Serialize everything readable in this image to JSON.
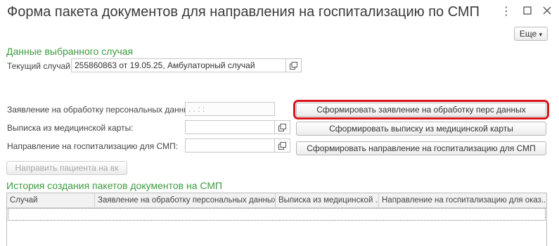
{
  "window": {
    "title": "Форма пакета документов для направления на госпитализацию по СМП",
    "more_label": "Еще"
  },
  "section_selected": {
    "title": "Данные выбранного случая",
    "current_case_label": "Текущий случай:",
    "current_case_value": "255860863 от 19.05.25, Амбулаторный случай"
  },
  "documents": {
    "consent_label": "Заявление на обработку персональных данных:",
    "consent_value": " .  .      :  :",
    "extract_label": "Выписка из медицинской карты:",
    "extract_value": "",
    "referral_label": "Направление на госпитализацию для СМП:",
    "referral_value": "",
    "btn_consent": "Сформировать заявление на обработку перс данных",
    "btn_extract": "Сформировать выписку из медицинской карты",
    "btn_referral": "Сформировать направление на госпитализацию для СМП",
    "btn_send_vk": "Направить пациента на вк"
  },
  "history": {
    "title": "История создания пакетов документов на СМП",
    "columns": [
      "Случай",
      "Заявление на обработку персональных данных",
      "Выписка из медицинской ...",
      "Направление на госпитализацию для оказ..."
    ],
    "rows": []
  },
  "colors": {
    "section_title": "#3d9a40",
    "highlight_border": "#d8141b"
  },
  "icons": {
    "window_menu": "kebab-icon",
    "maximize": "maximize-icon",
    "close": "close-icon",
    "open_form": "open-copy-icon",
    "dropdown": "chevron-down-icon"
  }
}
